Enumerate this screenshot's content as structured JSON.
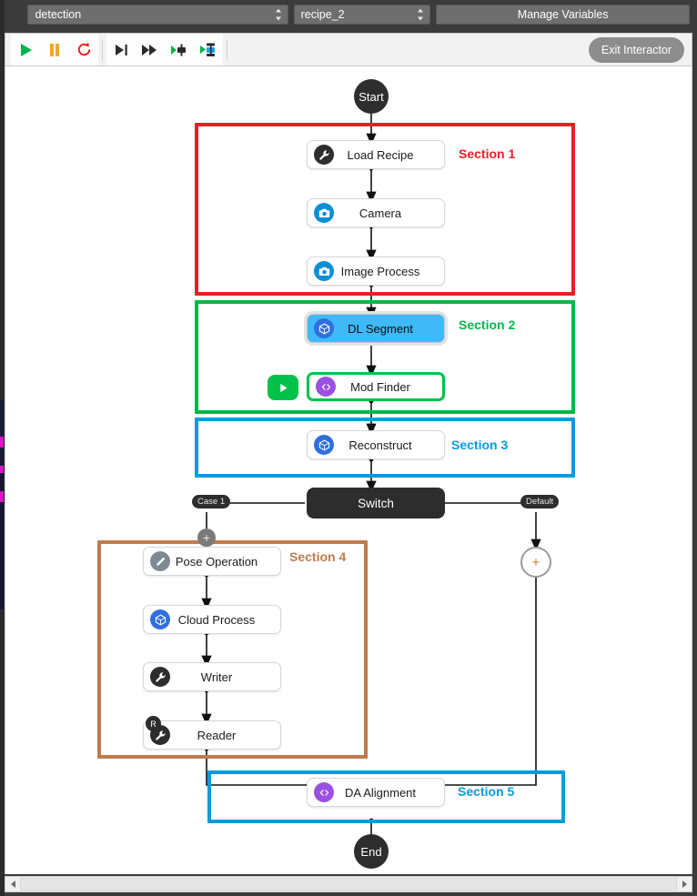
{
  "topbar": {
    "project_select": {
      "value": "detection",
      "icon": "chevron-updown-icon"
    },
    "recipe_select": {
      "value": "recipe_2",
      "icon": "chevron-updown-icon"
    },
    "manage_variables_label": "Manage Variables"
  },
  "toolbar": {
    "buttons": [
      {
        "name": "run-button",
        "icon": "play-icon",
        "color": "#00b24a"
      },
      {
        "name": "pause-button",
        "icon": "pause-icon",
        "color": "#f5a623"
      },
      {
        "name": "reset-button",
        "icon": "reload-icon",
        "color": "#e81b1b"
      },
      {
        "name": "step-into-button",
        "icon": "step-into-icon",
        "color": "#2b2b2b"
      },
      {
        "name": "step-over-button",
        "icon": "step-over-icon",
        "color": "#2b2b2b"
      },
      {
        "name": "run-to-node-button",
        "icon": "run-to-node-icon",
        "color": "#2b2b2b"
      },
      {
        "name": "run-from-node-button",
        "icon": "run-from-node-icon",
        "color": "#2b2b2b"
      }
    ],
    "exit_interactor_label": "Exit Interactor"
  },
  "flow": {
    "start_label": "Start",
    "end_label": "End",
    "switch_label": "Switch",
    "case1_label": "Case 1",
    "default_label": "Default",
    "plus_label": "+",
    "nodes": [
      {
        "label": "Load Recipe",
        "icon": "wrench-icon",
        "icon_bg": "#2d2d2d",
        "state": "normal"
      },
      {
        "label": "Camera",
        "icon": "camera-icon",
        "icon_bg": "#0c8fd6",
        "state": "normal"
      },
      {
        "label": "Image Process",
        "icon": "camera-icon",
        "icon_bg": "#0c8fd6",
        "state": "normal"
      },
      {
        "label": "DL Segment",
        "icon": "cube-icon",
        "icon_bg": "#2f6fe0",
        "state": "selected"
      },
      {
        "label": "Mod Finder",
        "icon": "code-icon",
        "icon_bg": "#9b51e0",
        "state": "breakpoint"
      },
      {
        "label": "Reconstruct",
        "icon": "cube-icon",
        "icon_bg": "#2f6fe0",
        "state": "normal"
      },
      {
        "label": "Pose Operation",
        "icon": "pen-icon",
        "icon_bg": "#7d8a94",
        "state": "normal"
      },
      {
        "label": "Cloud Process",
        "icon": "cube-icon",
        "icon_bg": "#2f6fe0",
        "state": "normal"
      },
      {
        "label": "Writer",
        "icon": "wrench-icon",
        "icon_bg": "#2d2d2d",
        "state": "normal"
      },
      {
        "label": "Reader",
        "icon": "wrench-icon",
        "icon_bg": "#2d2d2d",
        "state": "normal",
        "badge": "R"
      },
      {
        "label": "DA Alignment",
        "icon": "code-icon",
        "icon_bg": "#9b51e0",
        "state": "normal"
      }
    ],
    "sections": [
      {
        "label": "Section 1",
        "color": "#ef1c26"
      },
      {
        "label": "Section 2",
        "color": "#00b84a"
      },
      {
        "label": "Section 3",
        "color": "#069bde"
      },
      {
        "label": "Section 4",
        "color": "#bd7b4f"
      },
      {
        "label": "Section 5",
        "color": "#069bde"
      }
    ]
  },
  "scrollbar": {
    "left_arrow": "triangle-left-icon",
    "right_arrow": "triangle-right-icon"
  }
}
